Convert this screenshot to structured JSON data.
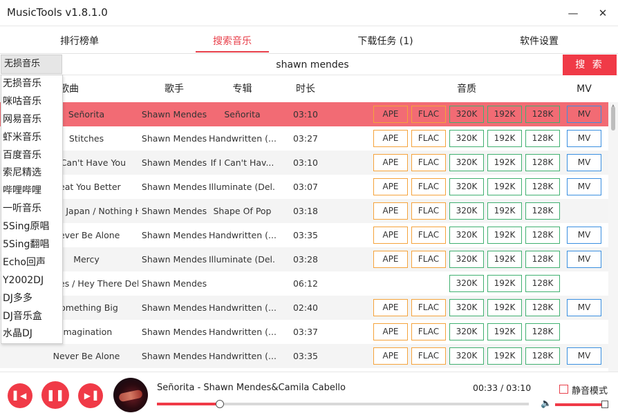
{
  "app": {
    "title": "MusicTools v1.8.1.0",
    "minimize": "—",
    "close": "✕"
  },
  "tabs": [
    {
      "label": "排行榜单"
    },
    {
      "label": "搜索音乐"
    },
    {
      "label": "下载任务 (1)"
    },
    {
      "label": "软件设置"
    }
  ],
  "active_tab": 1,
  "search": {
    "source_selected": "无损音乐",
    "query": "shawn mendes",
    "button": "搜 索"
  },
  "source_options": [
    "无损音乐",
    "咪咕音乐",
    "网易音乐",
    "虾米音乐",
    "百度音乐",
    "索尼精选",
    "哔哩哔哩",
    "一听音乐",
    "5Sing原唱",
    "5Sing翻唱",
    "Echo回声",
    "Y2002DJ",
    "DJ多多",
    "DJ音乐盒",
    "水晶DJ"
  ],
  "table": {
    "headers": {
      "title": "歌曲",
      "artist": "歌手",
      "album": "专辑",
      "duration": "时长",
      "quality": "音质",
      "mv": "MV"
    },
    "rows": [
      {
        "title": "Señorita",
        "artist": "Shawn Mendes",
        "album": "Señorita",
        "duration": "03:10",
        "ape": "APE",
        "flac": "FLAC",
        "k320": "320K",
        "k192": "192K",
        "k128": "128K",
        "mv": "MV"
      },
      {
        "title": "Stitches",
        "artist": "Shawn Mendes",
        "album": "Handwritten (...",
        "duration": "03:27",
        "ape": "APE",
        "flac": "FLAC",
        "k320": "320K",
        "k192": "192K",
        "k128": "128K",
        "mv": "MV"
      },
      {
        "title": "If I Can't Have You",
        "artist": "Shawn Mendes",
        "album": "If I Can't Hav...",
        "duration": "03:10",
        "ape": "APE",
        "flac": "FLAC",
        "k320": "320K",
        "k192": "192K",
        "k128": "128K",
        "mv": "MV"
      },
      {
        "title": "Treat You Better",
        "artist": "Shawn Mendes",
        "album": "Illuminate (Del...",
        "duration": "03:07",
        "ape": "APE",
        "flac": "FLAC",
        "k320": "320K",
        "k192": "192K",
        "k128": "128K",
        "mv": "MV"
      },
      {
        "title": "Lost In Japan / Nothing Holdin' Me Back",
        "artist": "Shawn Mendes",
        "album": "Shape Of Pop",
        "duration": "03:18",
        "ape": "APE",
        "flac": "FLAC",
        "k320": "320K",
        "k192": "192K",
        "k128": "128K",
        "mv": ""
      },
      {
        "title": "Never Be Alone",
        "artist": "Shawn Mendes",
        "album": "Handwritten (...",
        "duration": "03:35",
        "ape": "APE",
        "flac": "FLAC",
        "k320": "320K",
        "k192": "192K",
        "k128": "128K",
        "mv": "MV"
      },
      {
        "title": "Mercy",
        "artist": "Shawn Mendes",
        "album": "Illuminate (Del...",
        "duration": "03:28",
        "ape": "APE",
        "flac": "FLAC",
        "k320": "320K",
        "k192": "192K",
        "k128": "128K",
        "mv": "MV"
      },
      {
        "title": "Stitches / Hey There Del...",
        "artist": "Shawn Mendes",
        "album": "",
        "duration": "06:12",
        "ape": "",
        "flac": "",
        "k320": "320K",
        "k192": "192K",
        "k128": "128K",
        "mv": ""
      },
      {
        "title": "Something Big",
        "artist": "Shawn Mendes",
        "album": "Handwritten (...",
        "duration": "02:40",
        "ape": "APE",
        "flac": "FLAC",
        "k320": "320K",
        "k192": "192K",
        "k128": "128K",
        "mv": "MV"
      },
      {
        "title": "Imagination",
        "artist": "Shawn Mendes",
        "album": "Handwritten (...",
        "duration": "03:37",
        "ape": "APE",
        "flac": "FLAC",
        "k320": "320K",
        "k192": "192K",
        "k128": "128K",
        "mv": ""
      },
      {
        "title": "Never Be Alone",
        "artist": "Shawn Mendes",
        "album": "Handwritten (...",
        "duration": "03:35",
        "ape": "APE",
        "flac": "FLAC",
        "k320": "320K",
        "k192": "192K",
        "k128": "128K",
        "mv": "MV"
      },
      {
        "title": "",
        "artist": "",
        "album": "",
        "duration": "",
        "ape": "",
        "flac": "",
        "k320": "",
        "k192": "",
        "k128": "",
        "mv": ""
      }
    ]
  },
  "player": {
    "now_playing": "Señorita - Shawn Mendes&Camila Cabello",
    "time": "00:33 / 03:10",
    "progress": 0.17,
    "mute_label": "静音模式",
    "mute_checked": false,
    "volume": 1.0
  },
  "colors": {
    "accent": "#f03a47",
    "selected_row": "#f26b74",
    "lossless_border": "#f5a33b",
    "mp3_border": "#40b070",
    "mv_border": "#3a8fe0"
  },
  "icons": {
    "prev": "skip-back-icon",
    "play_pause": "pause-icon",
    "next": "skip-forward-icon",
    "volume": "speaker-icon"
  }
}
